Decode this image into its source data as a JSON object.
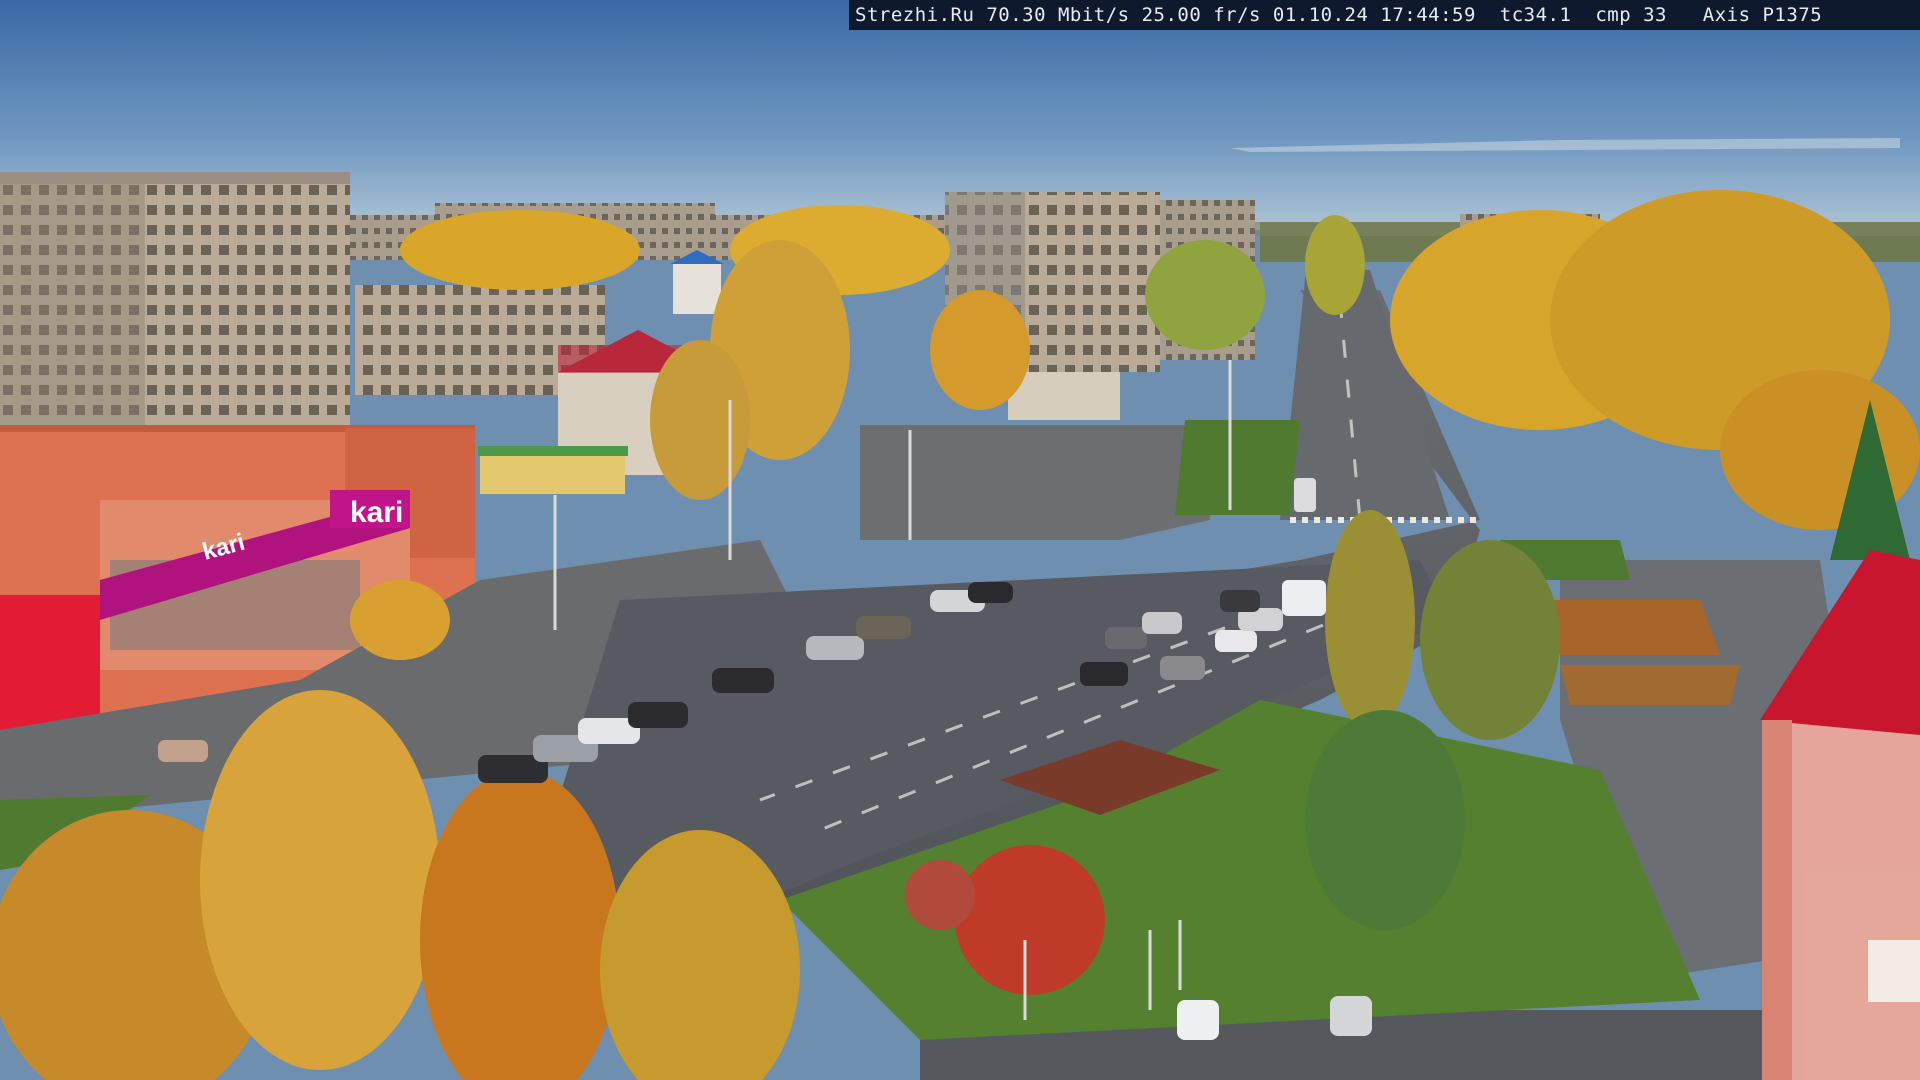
{
  "overlay": {
    "site": "Strezhi.Ru",
    "bitrate": "70.30 Mbit/s",
    "fps": "25.00 fr/s",
    "date": "01.10.24",
    "time": "17:44:59",
    "tc": "tc34.1",
    "cmp": "cmp 33",
    "camera": "Axis P1375"
  },
  "signs": {
    "store_logo": "kari",
    "banner_logo": "kari"
  },
  "colors": {
    "sky_top": "#3f6fa8",
    "sky_horizon": "#a9c1d3",
    "road": "#5d6066",
    "birch_gold": "#d9a62a",
    "grass": "#4f7a2f",
    "kari_magenta": "#b0127e",
    "store_orange": "#e0734f"
  }
}
